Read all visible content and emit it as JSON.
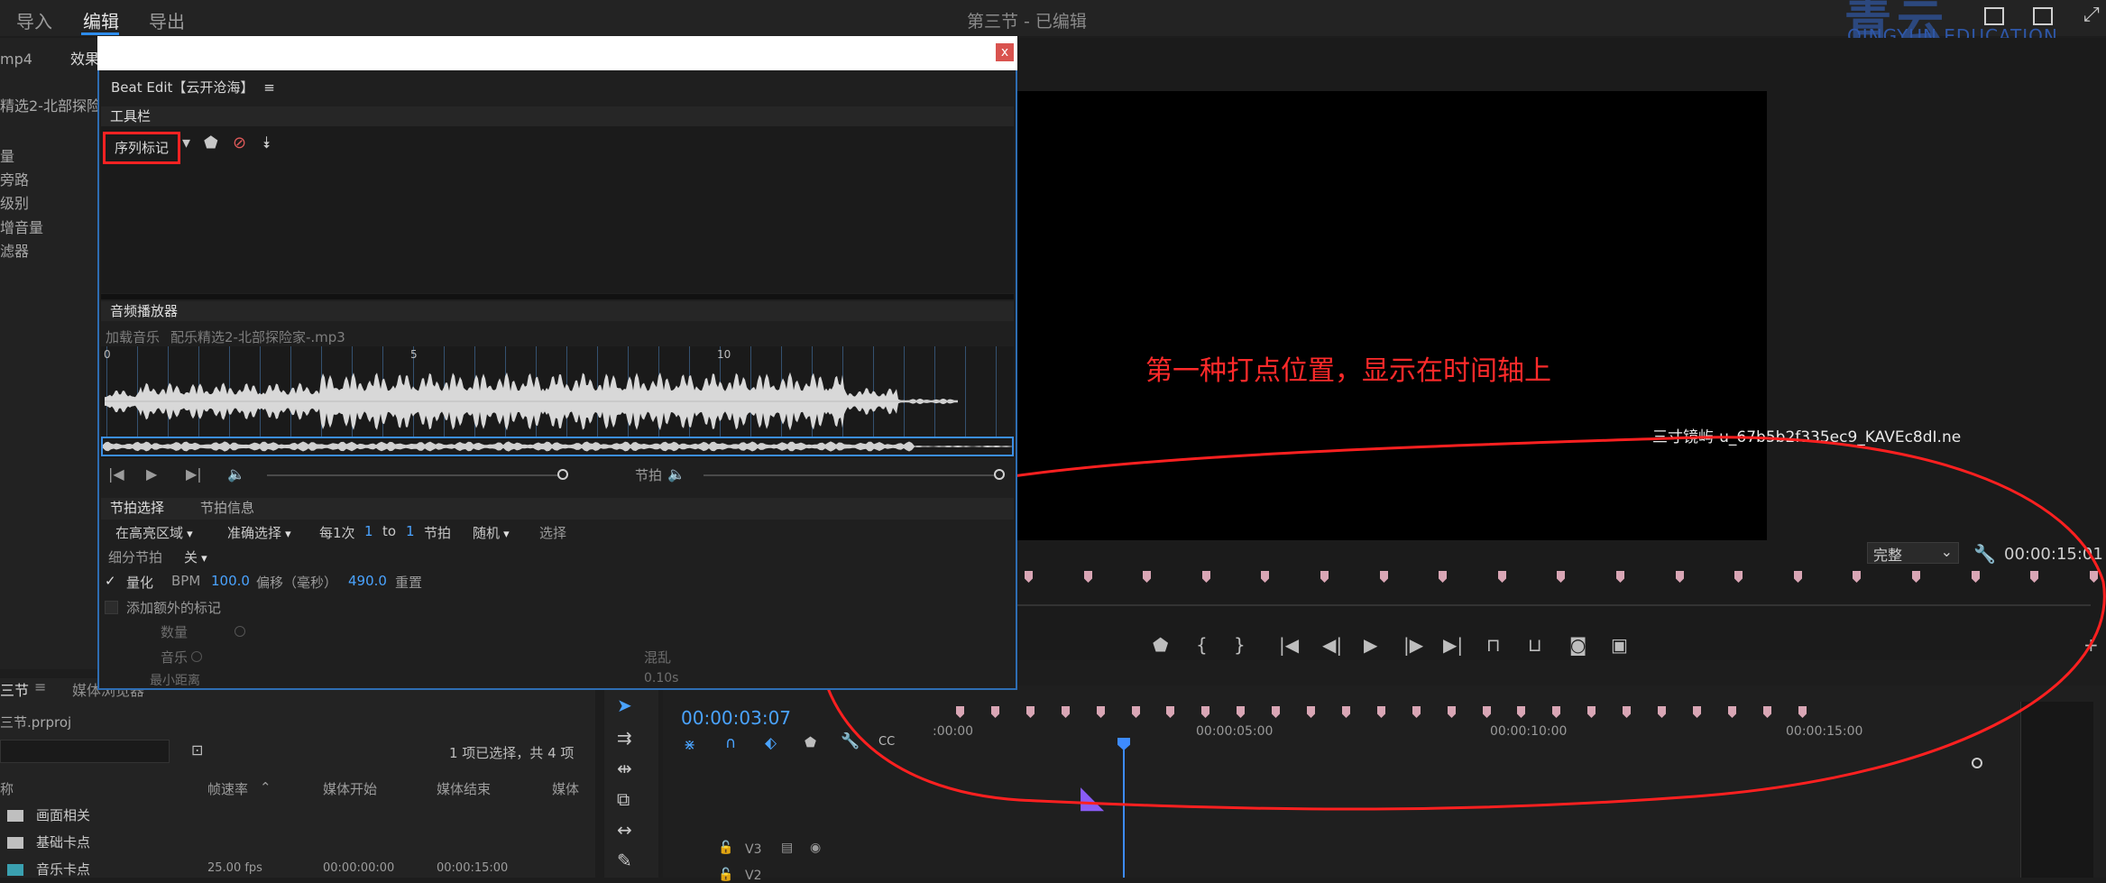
{
  "menu": {
    "import": "导入",
    "edit": "编辑",
    "export": "导出"
  },
  "doc_title": "第三节 - 已编辑",
  "logo": {
    "main": "青云",
    "sub": "QINGYUN EDUCATION"
  },
  "left_panel": {
    "tab_file": "mp4",
    "tab_effects": "效果",
    "clip": "精选2-北部探险",
    "items": [
      "量",
      "旁路",
      "级别",
      "增音量",
      "滤器"
    ]
  },
  "dialog": {
    "name": "Beat Edit【云开沧海】",
    "menu_icon": "≡",
    "close": "x",
    "toolbar_title": "工具栏",
    "seq_marker_button": "序列标记",
    "player_title": "音频播放器",
    "load_music": "加载音乐",
    "file_name": "配乐精选2-北部探险家-.mp3",
    "wave_numbers": [
      "0",
      "5",
      "10"
    ],
    "beat_label": "节拍",
    "tab_beat_select": "节拍选择",
    "tab_beat_info": "节拍信息",
    "opt_region": "在高亮区域",
    "opt_precise": "准确选择",
    "opt_every": "每1次",
    "opt_from": "1",
    "opt_to": "to",
    "opt_to_val": "1",
    "opt_beat": "节拍",
    "opt_random": "随机",
    "opt_select": "选择",
    "subdivide_label": "细分节拍",
    "subdivide_value": "关",
    "quantize_label": "量化",
    "bpm_label": "BPM",
    "bpm_value": "100.0",
    "offset_label": "偏移（毫秒）",
    "offset_value": "490.0",
    "reset_label": "重置",
    "extra_marker_label": "添加额外的标记",
    "count_label": "数量",
    "music_label": "音乐",
    "mix_label": "混乱",
    "min_label": "最小距离",
    "min_value": "0.10s"
  },
  "monitor": {
    "annotation": "第一种打点位置，显示在时间轴上",
    "file_caption": "三寸镜屿-u_67b5b2f335ec9_KAVEc8dI.ne",
    "quality": "完整",
    "timecode": "00:00:15:01"
  },
  "project": {
    "tab_name": "三节",
    "tab_media": "媒体浏览器",
    "file": "三节.prproj",
    "selection_info": "1 项已选择，共 4 项",
    "headers": [
      "称",
      "帧速率",
      "媒体开始",
      "媒体结束",
      "媒体"
    ],
    "rows": [
      {
        "name": "画面相关",
        "fps": "",
        "start": "",
        "end": ""
      },
      {
        "name": "基础卡点",
        "fps": "",
        "start": "",
        "end": ""
      },
      {
        "name": "音乐卡点",
        "fps": "25.00 fps",
        "start": "00:00:00:00",
        "end": "00:00:15:00"
      }
    ]
  },
  "timeline": {
    "timecode": "00:00:03:07",
    "ticks": [
      ":00:00",
      "00:00:05:00",
      "00:00:10:00",
      "00:00:15:00"
    ],
    "track_v3": "V3",
    "track_v2": "V2"
  }
}
